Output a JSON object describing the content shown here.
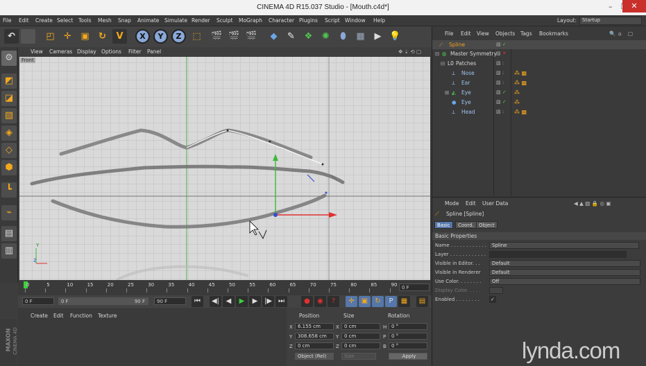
{
  "window": {
    "title": "CINEMA 4D R15.037 Studio - [Mouth.c4d*]",
    "minimize": "–",
    "maximize": "❐",
    "close": "✕"
  },
  "menu": {
    "items": [
      "File",
      "Edit",
      "Create",
      "Select",
      "Tools",
      "Mesh",
      "Snap",
      "Animate",
      "Simulate",
      "Render",
      "Sculpt",
      "MoGraph",
      "Character",
      "Plugins",
      "Script",
      "Window",
      "Help"
    ],
    "layout_label": "Layout:",
    "layout_value": "Startup"
  },
  "toolbar": {
    "undo_icon": "undo-icon",
    "axis_x": "X",
    "axis_y": "Y",
    "axis_z": "Z"
  },
  "viewport": {
    "menu": [
      "View",
      "Cameras",
      "Display",
      "Options",
      "Filter",
      "Panel"
    ],
    "camera_label": "Front",
    "axis_y_label": "Y",
    "axis_z_label": "Z"
  },
  "timeline": {
    "ticks": [
      "0",
      "5",
      "10",
      "15",
      "20",
      "25",
      "30",
      "35",
      "40",
      "45",
      "50",
      "55",
      "60",
      "65",
      "70",
      "75",
      "80",
      "85",
      "90"
    ],
    "current_frame": "0 F"
  },
  "playback": {
    "start_frame": "0 F",
    "range_start": "0 F",
    "range_end": "90 F",
    "end_frame": "90 F"
  },
  "material": {
    "menu": [
      "Create",
      "Edit",
      "Function",
      "Texture"
    ],
    "brand_top": "MAXON",
    "brand_bottom": "CINEMA 4D"
  },
  "coordinates": {
    "headers": [
      "Position",
      "Size",
      "Rotation"
    ],
    "rows": [
      {
        "axis": "X",
        "pos": "6.155 cm",
        "size_axis": "X",
        "size": "0 cm",
        "rot_axis": "H",
        "rot": "0 °"
      },
      {
        "axis": "Y",
        "pos": "308.658 cm",
        "size_axis": "Y",
        "size": "0 cm",
        "rot_axis": "P",
        "rot": "0 °"
      },
      {
        "axis": "Z",
        "pos": "0 cm",
        "size_axis": "Z",
        "size": "0 cm",
        "rot_axis": "B",
        "rot": "0 °"
      }
    ],
    "mode": "Object (Rel)",
    "size_mode": "Size",
    "apply": "Apply"
  },
  "objects": {
    "menu": [
      "File",
      "Edit",
      "View",
      "Objects",
      "Tags",
      "Bookmarks"
    ],
    "items": [
      {
        "name": "Spline",
        "color": "#f0a020"
      },
      {
        "name": "Master Symmetry",
        "color": "#c8c8c8"
      },
      {
        "name": "Patches",
        "color": "#c8c8c8"
      },
      {
        "name": "Nose",
        "color": "#9fc3f0"
      },
      {
        "name": "Ear",
        "color": "#9fc3f0"
      },
      {
        "name": "Eye",
        "color": "#9fc3f0"
      },
      {
        "name": "Eye",
        "color": "#9fc3f0"
      },
      {
        "name": "Head",
        "color": "#9fc3f0"
      }
    ]
  },
  "attributes": {
    "menu": [
      "Mode",
      "Edit",
      "User Data"
    ],
    "object_title": "Spline [Spline]",
    "tabs": [
      "Basic",
      "Coord.",
      "Object"
    ],
    "section": "Basic Properties",
    "props": [
      {
        "label": "Name . . . . . . . . . . . .",
        "value": "Spline"
      },
      {
        "label": "Layer . . . . . . . . . . . .",
        "value": ""
      },
      {
        "label": "Visible in Editor. . .",
        "value": "Default"
      },
      {
        "label": "Visible in Renderer",
        "value": "Default"
      },
      {
        "label": "Use Color. . . . . . . .",
        "value": "Off"
      },
      {
        "label": "Display Color. . . . .",
        "value": ""
      },
      {
        "label": "Enabled . . . . . . . .",
        "value": "✓"
      }
    ]
  },
  "watermark": "lynda.com"
}
